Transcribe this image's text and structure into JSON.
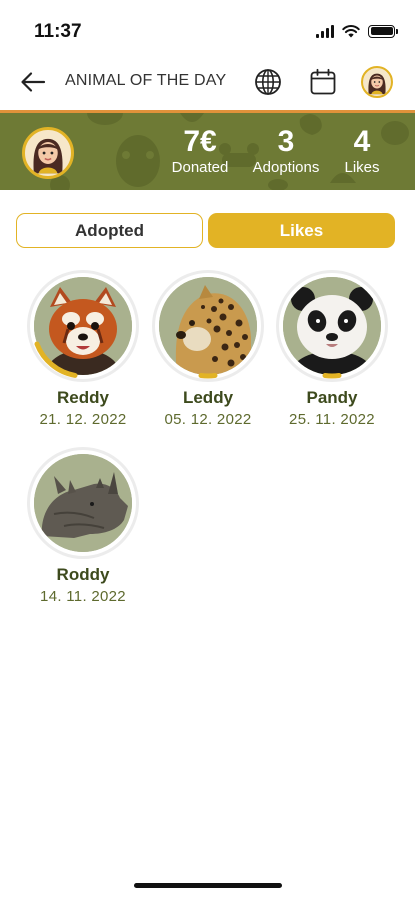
{
  "status_bar": {
    "time": "11:37"
  },
  "header": {
    "title": "ANIMAL OF THE DAY"
  },
  "stats": {
    "donated_value": "7€",
    "donated_label": "Donated",
    "adoptions_value": "3",
    "adoptions_label": "Adoptions",
    "likes_value": "4",
    "likes_label": "Likes"
  },
  "tabs": {
    "adopted_label": "Adopted",
    "likes_label": "Likes",
    "active": "likes"
  },
  "animals": [
    {
      "name": "Reddy",
      "date": "21. 12. 2022",
      "species": "red-panda",
      "progress": 0.3
    },
    {
      "name": "Leddy",
      "date": "05. 12. 2022",
      "species": "leopard",
      "progress": 0.05
    },
    {
      "name": "Pandy",
      "date": "25. 11. 2022",
      "species": "giant-panda",
      "progress": 0.05
    },
    {
      "name": "Roddy",
      "date": "14. 11. 2022",
      "species": "rhinoceros",
      "progress": 0
    }
  ],
  "colors": {
    "accent": "#e2b325",
    "banner": "#6e7a35",
    "text_dark_green": "#3d4a1d",
    "orange_line": "#e0923a"
  }
}
